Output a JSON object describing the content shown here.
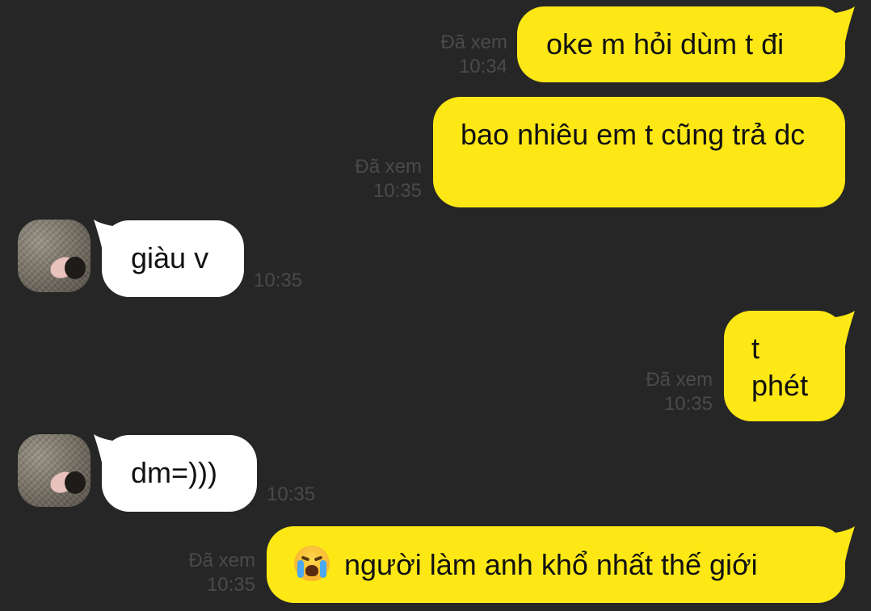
{
  "messages": [
    {
      "side": "out",
      "text": "oke m hỏi dùm t đi",
      "status": "Đã xem",
      "time": "10:34"
    },
    {
      "side": "out",
      "text": "bao nhiêu em t cũng trả dc",
      "status": "Đã xem",
      "time": "10:35"
    },
    {
      "side": "in",
      "text": "giàu v",
      "time": "10:35"
    },
    {
      "side": "out",
      "text": "t phét",
      "status": "Đã xem",
      "time": "10:35"
    },
    {
      "side": "in",
      "text": "dm=)))",
      "time": "10:35"
    },
    {
      "side": "out",
      "emoji": "loudly-crying-face-icon",
      "text": "người làm anh khổ nhất thế giới",
      "status": "Đã xem",
      "time": "10:35"
    }
  ],
  "colors": {
    "background": "#262626",
    "outgoing_bubble": "#fde815",
    "incoming_bubble": "#ffffff",
    "meta_text": "#4a4a4a"
  }
}
